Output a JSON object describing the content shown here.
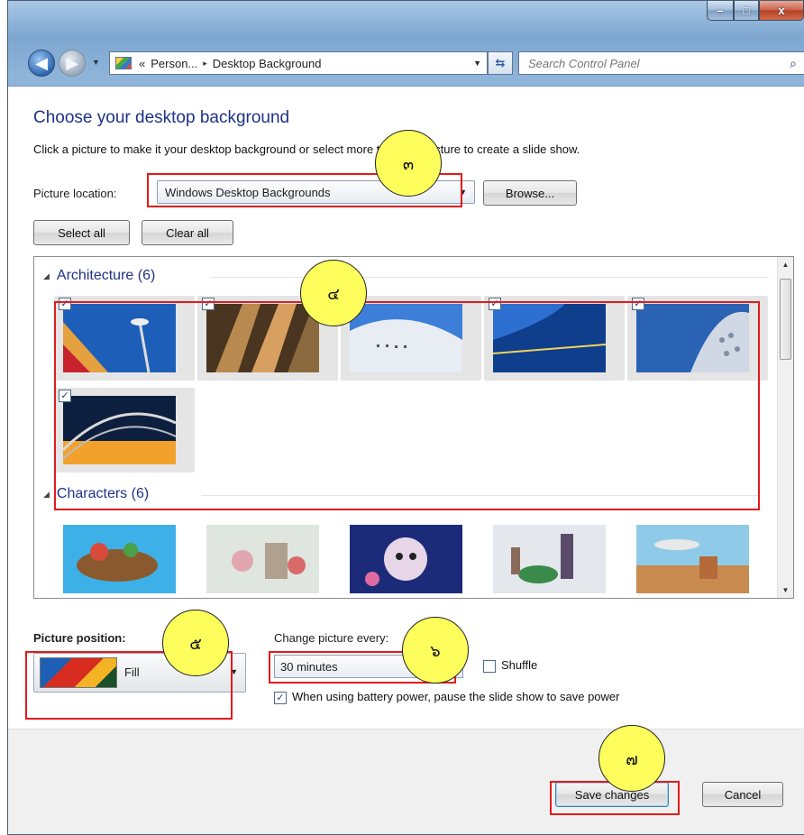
{
  "titlebar": {
    "minimize": "–",
    "maximize": "□",
    "close": "x"
  },
  "nav": {
    "back_glyph": "◀",
    "forward_glyph": "▶",
    "address": {
      "prefix": "«",
      "crumb1": "Person...",
      "separator": "▸",
      "crumb2": "Desktop Background"
    },
    "search_placeholder": "Search Control Panel"
  },
  "page": {
    "heading": "Choose your desktop background",
    "instruction": "Click a picture to make it your desktop background or select more than one picture to create a slide show.",
    "location_label": "Picture location:",
    "location_value": "Windows Desktop Backgrounds",
    "browse_label": "Browse...",
    "select_all_label": "Select all",
    "clear_all_label": "Clear all"
  },
  "gallery": {
    "groups": [
      {
        "title": "Architecture (6)",
        "checked_count": 6
      },
      {
        "title": "Characters (6)",
        "checked_count": 0
      }
    ],
    "check_glyph": "✓"
  },
  "position": {
    "label": "Picture position:",
    "value": "Fill"
  },
  "slideshow": {
    "label": "Change picture every:",
    "value": "30 minutes",
    "shuffle_label": "Shuffle",
    "shuffle_checked": false,
    "battery_label": "When using battery power, pause the slide show to save power",
    "battery_checked": true
  },
  "footer": {
    "save_label": "Save changes",
    "cancel_label": "Cancel"
  },
  "annotations": [
    {
      "name": "callout-3",
      "text": "๓"
    },
    {
      "name": "callout-4",
      "text": "๔"
    },
    {
      "name": "callout-5",
      "text": "๕"
    },
    {
      "name": "callout-6",
      "text": "๖"
    },
    {
      "name": "callout-7",
      "text": "๗"
    }
  ],
  "colors": {
    "heading": "#1e3287",
    "annotation_box": "#e21b1b",
    "annotation_circle": "#fdfd5c"
  }
}
